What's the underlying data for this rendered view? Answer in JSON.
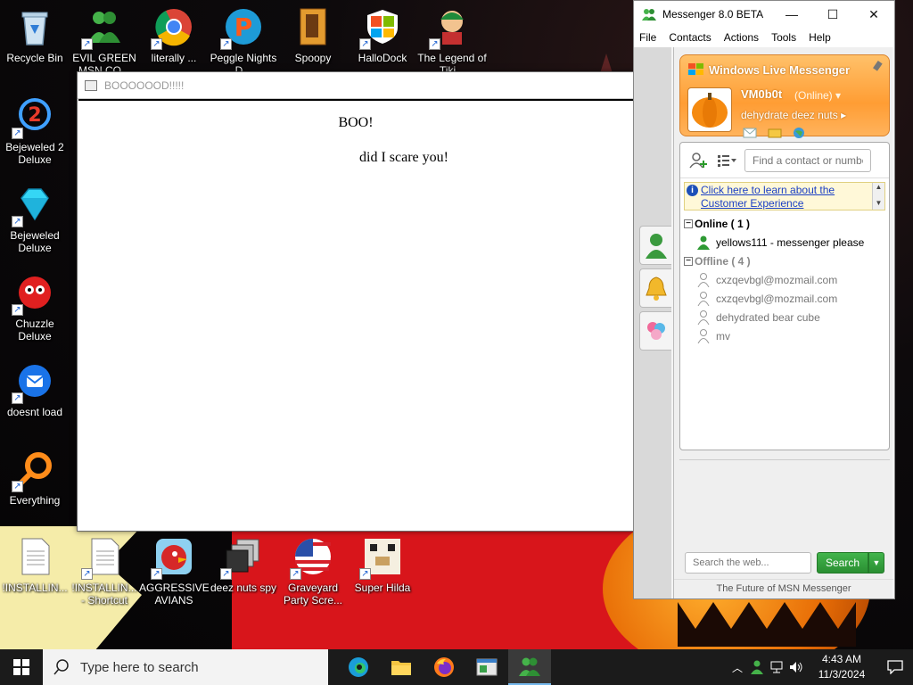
{
  "desktop": {
    "icons": [
      {
        "label": "Recycle Bin"
      },
      {
        "label": "EVIL GREEN MSN CO..."
      },
      {
        "label": "literally ..."
      },
      {
        "label": "Peggle Nights D..."
      },
      {
        "label": "Spoopy"
      },
      {
        "label": "HalloDock"
      },
      {
        "label": "The Legend of Tiki..."
      },
      {
        "label": "Bejeweled 2 Deluxe"
      },
      {
        "label": "Bejeweled Deluxe"
      },
      {
        "label": "Chuzzle Deluxe"
      },
      {
        "label": "doesnt load"
      },
      {
        "label": "Everything"
      },
      {
        "label": "!INSTALLIN..."
      },
      {
        "label": "!INSTALLIN... - Shortcut"
      },
      {
        "label": "AGGRESSIVE AVIANS"
      },
      {
        "label": "deez nuts spy"
      },
      {
        "label": "Graveyard Party Scre..."
      },
      {
        "label": "Super Hilda"
      }
    ]
  },
  "popup": {
    "title": "BOOOOOOD!!!!!",
    "heading": "BOO!",
    "text": "did I scare you!"
  },
  "messenger": {
    "window_title": "Messenger 8.0 BETA",
    "menu": [
      "File",
      "Contacts",
      "Actions",
      "Tools",
      "Help"
    ],
    "brand": "Windows Live Messenger",
    "username": "VM0b0t",
    "status": "(Online)",
    "personal_message": "dehydrate deez nuts",
    "search_placeholder": "Find a contact or number",
    "info_link": "Click here to learn about the Customer Experience",
    "groups": [
      {
        "name": "Online ( 1 )",
        "contacts": [
          "yellows111 - messenger please"
        ]
      },
      {
        "name": "Offline ( 4 )",
        "contacts": [
          "cxzqevbgl@mozmail.com",
          "cxzqevbgl@mozmail.com",
          "dehydrated bear cube",
          "mv"
        ]
      }
    ],
    "web_search_placeholder": "Search the web...",
    "search_button": "Search",
    "footer": "The Future of MSN Messenger"
  },
  "taskbar": {
    "search_text": "Type here to search",
    "time": "4:43 AM",
    "date": "11/3/2024"
  },
  "colors": {
    "header_orange": "#ff9d34",
    "search_green": "#2a8f32",
    "link_blue": "#1a3fc4"
  }
}
